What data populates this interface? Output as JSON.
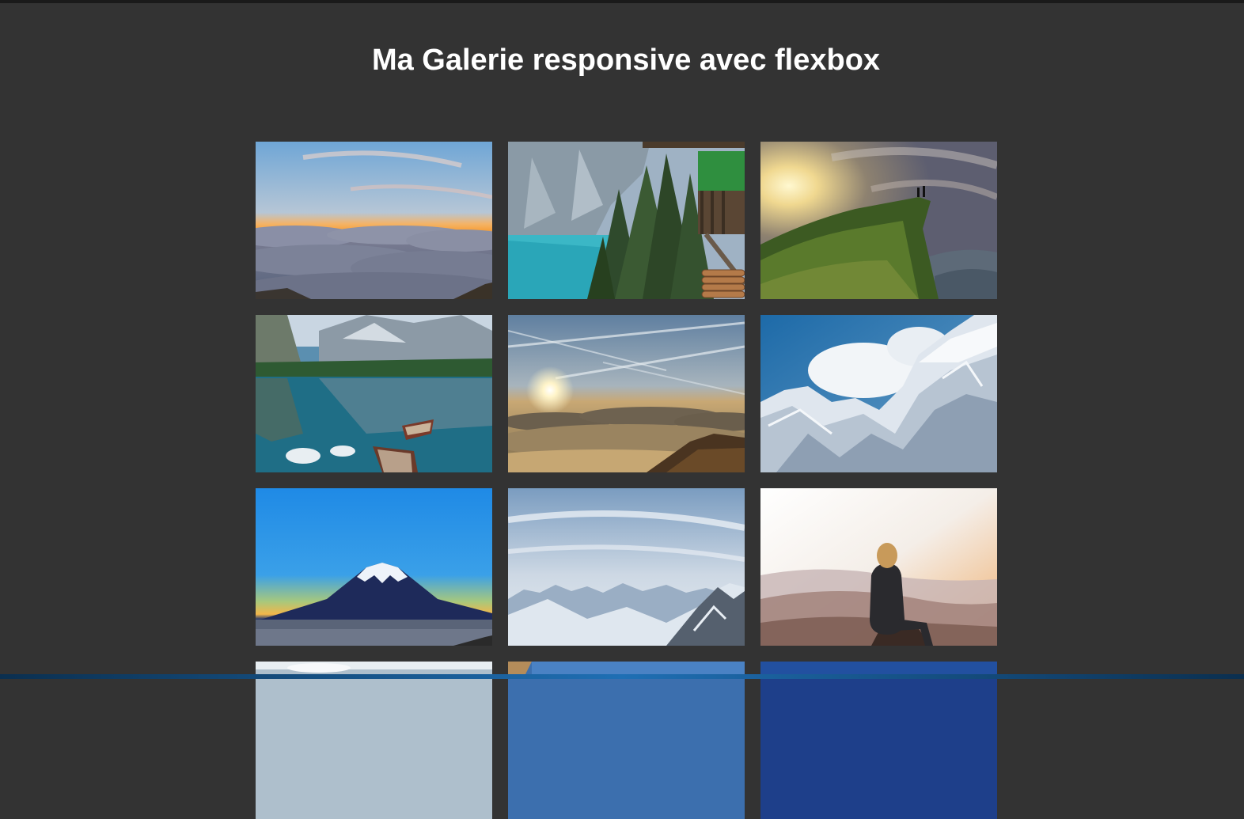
{
  "page": {
    "title": "Ma Galerie responsive avec flexbox"
  },
  "gallery": {
    "images": [
      {
        "subject": "sunset-over-clouds"
      },
      {
        "subject": "alpine-lake-with-pines-and-cabin"
      },
      {
        "subject": "hikers-on-cliff-at-sunrise"
      },
      {
        "subject": "boats-on-mountain-lake"
      },
      {
        "subject": "sun-above-sea-of-clouds"
      },
      {
        "subject": "snowy-mountain-ridge"
      },
      {
        "subject": "mount-fuji-at-dusk"
      },
      {
        "subject": "snowy-alps-panorama"
      },
      {
        "subject": "woman-sitting-on-rock-at-sunrise"
      },
      {
        "subject": "partial-mountain-photo"
      },
      {
        "subject": "partial-mountain-photo"
      },
      {
        "subject": "partial-mountain-photo"
      }
    ]
  },
  "colors": {
    "background": "#333333",
    "title": "#ffffff"
  }
}
